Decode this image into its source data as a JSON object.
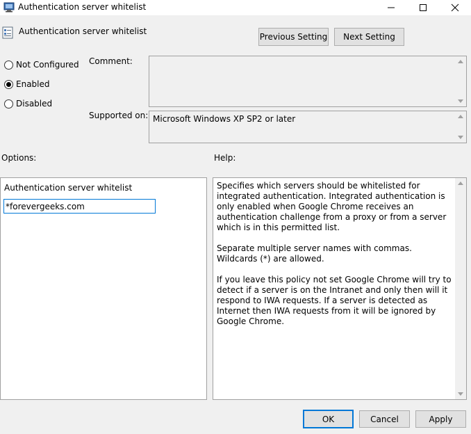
{
  "window": {
    "title": "Authentication server whitelist",
    "controls": {
      "minimize": "minimize",
      "maximize": "maximize",
      "close": "close"
    }
  },
  "header": {
    "setting_title": "Authentication server whitelist",
    "previous_label": "Previous Setting",
    "next_label": "Next Setting"
  },
  "state": {
    "options": [
      {
        "label": "Not Configured",
        "checked": false
      },
      {
        "label": "Enabled",
        "checked": true
      },
      {
        "label": "Disabled",
        "checked": false
      }
    ]
  },
  "comment": {
    "label": "Comment:",
    "value": ""
  },
  "supported": {
    "label": "Supported on:",
    "value": "Microsoft Windows XP SP2 or later"
  },
  "options_panel": {
    "heading": "Options:",
    "field_label": "Authentication server whitelist",
    "field_value": "*forevergeeks.com"
  },
  "help_panel": {
    "heading": "Help:",
    "paragraphs": [
      "Specifies which servers should be whitelisted for integrated authentication. Integrated authentication is only enabled when Google Chrome receives an authentication challenge from a proxy or from a server which is in this permitted list.",
      "Separate multiple server names with commas. Wildcards (*) are allowed.",
      "If you leave this policy not set Google Chrome will try to detect if a server is on the Intranet and only then will it respond to IWA requests.  If a server is detected as Internet then IWA requests from it will be ignored by Google Chrome."
    ]
  },
  "footer": {
    "ok_label": "OK",
    "cancel_label": "Cancel",
    "apply_label": "Apply"
  },
  "colors": {
    "accent": "#0078d7",
    "dialog_bg": "#f0f0f0",
    "border": "#a0a0a0"
  }
}
